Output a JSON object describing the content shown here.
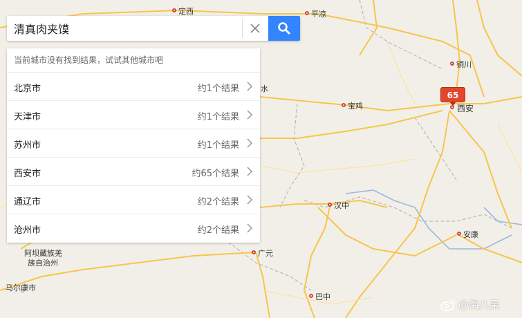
{
  "search": {
    "query": "清真肉夹馍"
  },
  "results": {
    "notice": "当前城市没有找到结果，试试其他城市吧",
    "rows": [
      {
        "city": "北京市",
        "count": "约1个结果"
      },
      {
        "city": "天津市",
        "count": "约1个结果"
      },
      {
        "city": "苏州市",
        "count": "约1个结果"
      },
      {
        "city": "西安市",
        "count": "约65个结果"
      },
      {
        "city": "通辽市",
        "count": "约2个结果"
      },
      {
        "city": "沧州市",
        "count": "约2个结果"
      }
    ]
  },
  "map": {
    "marker_count": "65",
    "labels": {
      "dingxi": "定西",
      "pingliang": "平凉",
      "tongchuan": "铜川",
      "baoji": "宝鸡",
      "xian": "西安",
      "hanzhong": "汉中",
      "ankang": "安康",
      "guangyuan": "广元",
      "bazhong": "巴中",
      "aba1": "阿坝藏族羌",
      "aba2": "族自治州",
      "maerkang": "马尔康市",
      "shui": "水"
    }
  },
  "watermark": {
    "text": "@海八呆"
  },
  "colors": {
    "search_button": "#3385ff",
    "marker": "#e2462c",
    "highway": "#f7c54a",
    "river": "#9ab8d8"
  }
}
